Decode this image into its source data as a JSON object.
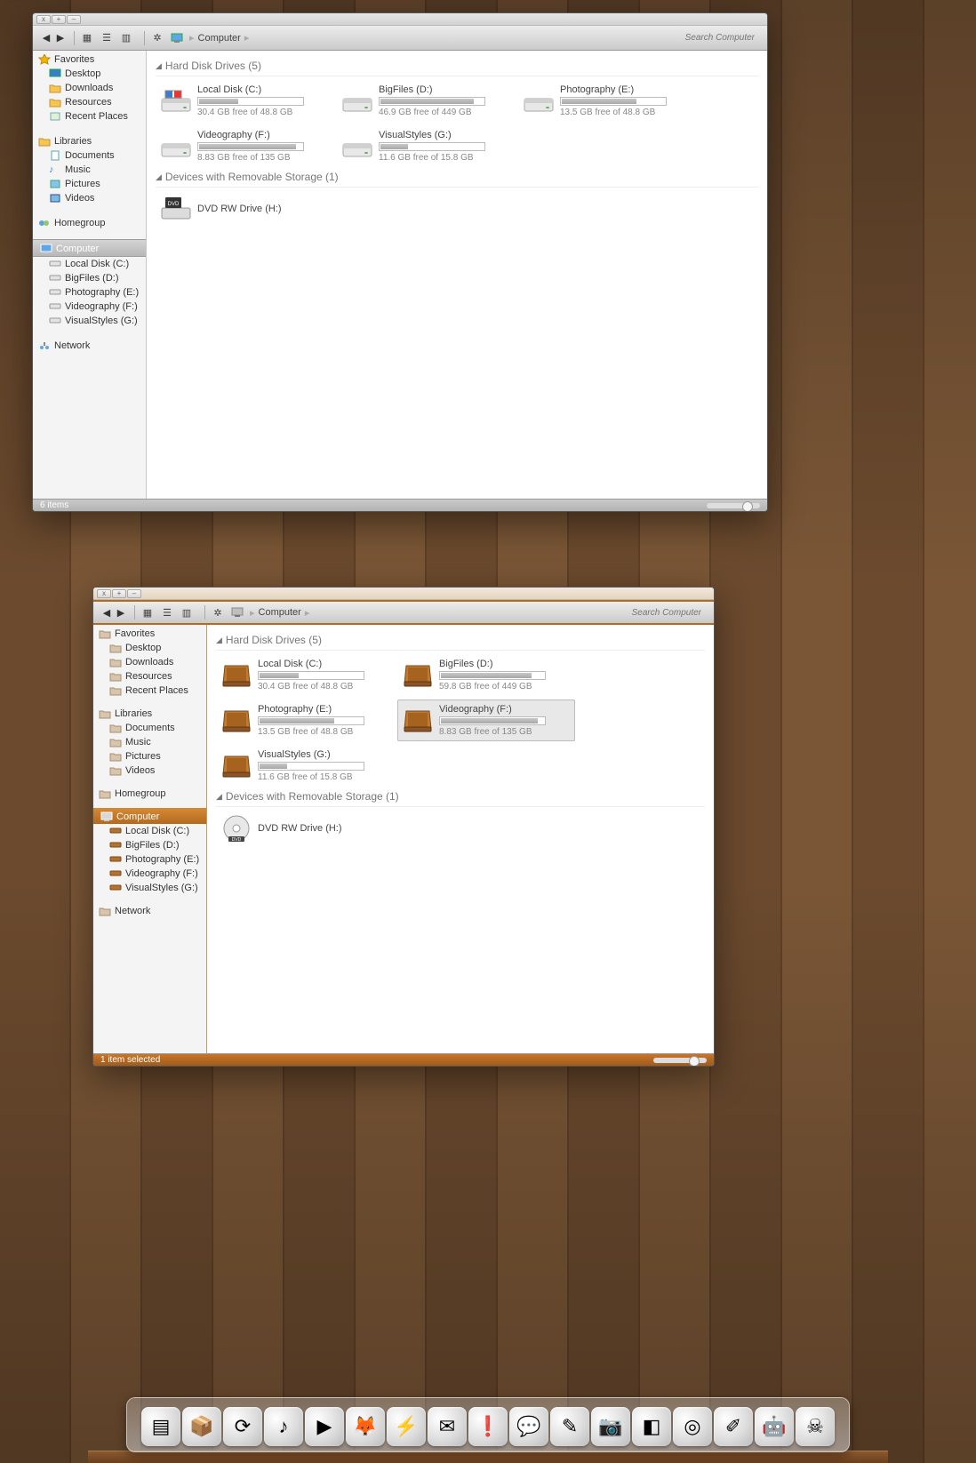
{
  "w1": {
    "breadcrumb": "Computer",
    "searchPlaceholder": "Search Computer",
    "status": "6 items",
    "sidebar": {
      "favoritesHeader": "Favorites",
      "favorites": [
        "Desktop",
        "Downloads",
        "Resources",
        "Recent Places"
      ],
      "librariesHeader": "Libraries",
      "libraries": [
        "Documents",
        "Music",
        "Pictures",
        "Videos"
      ],
      "homegroupHeader": "Homegroup",
      "computerHeader": "Computer",
      "drives": [
        "Local Disk (C:)",
        "BigFiles (D:)",
        "Photography (E:)",
        "Videography (F:)",
        "VisualStyles (G:)"
      ],
      "networkHeader": "Network"
    },
    "groups": [
      {
        "title": "Hard Disk Drives (5)",
        "drives": [
          {
            "name": "Local Disk (C:)",
            "free": "30.4 GB free of 48.8 GB",
            "pct": 38
          },
          {
            "name": "BigFiles (D:)",
            "free": "46.9 GB free of 449 GB",
            "pct": 90
          },
          {
            "name": "Photography (E:)",
            "free": "13.5 GB free of 48.8 GB",
            "pct": 72
          },
          {
            "name": "Videography (F:)",
            "free": "8.83 GB free of 135 GB",
            "pct": 93
          },
          {
            "name": "VisualStyles (G:)",
            "free": "11.6 GB free of 15.8 GB",
            "pct": 27
          }
        ]
      },
      {
        "title": "Devices with Removable Storage (1)",
        "drives": [
          {
            "name": "DVD RW Drive (H:)"
          }
        ]
      }
    ]
  },
  "w2": {
    "breadcrumb": "Computer",
    "searchPlaceholder": "Search Computer",
    "status": "1 item selected",
    "sidebar": {
      "favoritesHeader": "Favorites",
      "favorites": [
        "Desktop",
        "Downloads",
        "Resources",
        "Recent Places"
      ],
      "librariesHeader": "Libraries",
      "libraries": [
        "Documents",
        "Music",
        "Pictures",
        "Videos"
      ],
      "homegroupHeader": "Homegroup",
      "computerHeader": "Computer",
      "drives": [
        "Local Disk (C:)",
        "BigFiles (D:)",
        "Photography (E:)",
        "Videography (F:)",
        "VisualStyles (G:)"
      ],
      "networkHeader": "Network"
    },
    "groups": [
      {
        "title": "Hard Disk Drives (5)",
        "drives": [
          {
            "name": "Local Disk (C:)",
            "free": "30.4 GB free of 48.8 GB",
            "pct": 38
          },
          {
            "name": "BigFiles (D:)",
            "free": "59.8 GB free of 449 GB",
            "pct": 87
          },
          {
            "name": "Photography (E:)",
            "free": "13.5 GB free of 48.8 GB",
            "pct": 72
          },
          {
            "name": "Videography (F:)",
            "free": "8.83 GB free of 135 GB",
            "pct": 93,
            "sel": true
          },
          {
            "name": "VisualStyles (G:)",
            "free": "11.6 GB free of 15.8 GB",
            "pct": 27
          }
        ]
      },
      {
        "title": "Devices with Removable Storage (1)",
        "drives": [
          {
            "name": "DVD RW Drive (H:)"
          }
        ]
      }
    ]
  },
  "dock": [
    "finder-icon",
    "box-icon",
    "timemachine-icon",
    "music-icon",
    "play-icon",
    "firefox-icon",
    "lightning-icon",
    "mail-icon",
    "alert-icon",
    "im-icon",
    "note-icon",
    "camera-icon",
    "photos-icon",
    "aperture-icon",
    "dev-icon",
    "robot-icon",
    "skull-icon"
  ],
  "dockGlyphs": [
    "▤",
    "📦",
    "⟳",
    "♪",
    "▶",
    "🦊",
    "⚡",
    "✉",
    "❗",
    "💬",
    "✎",
    "📷",
    "◧",
    "◎",
    "✐",
    "🤖",
    "☠"
  ]
}
